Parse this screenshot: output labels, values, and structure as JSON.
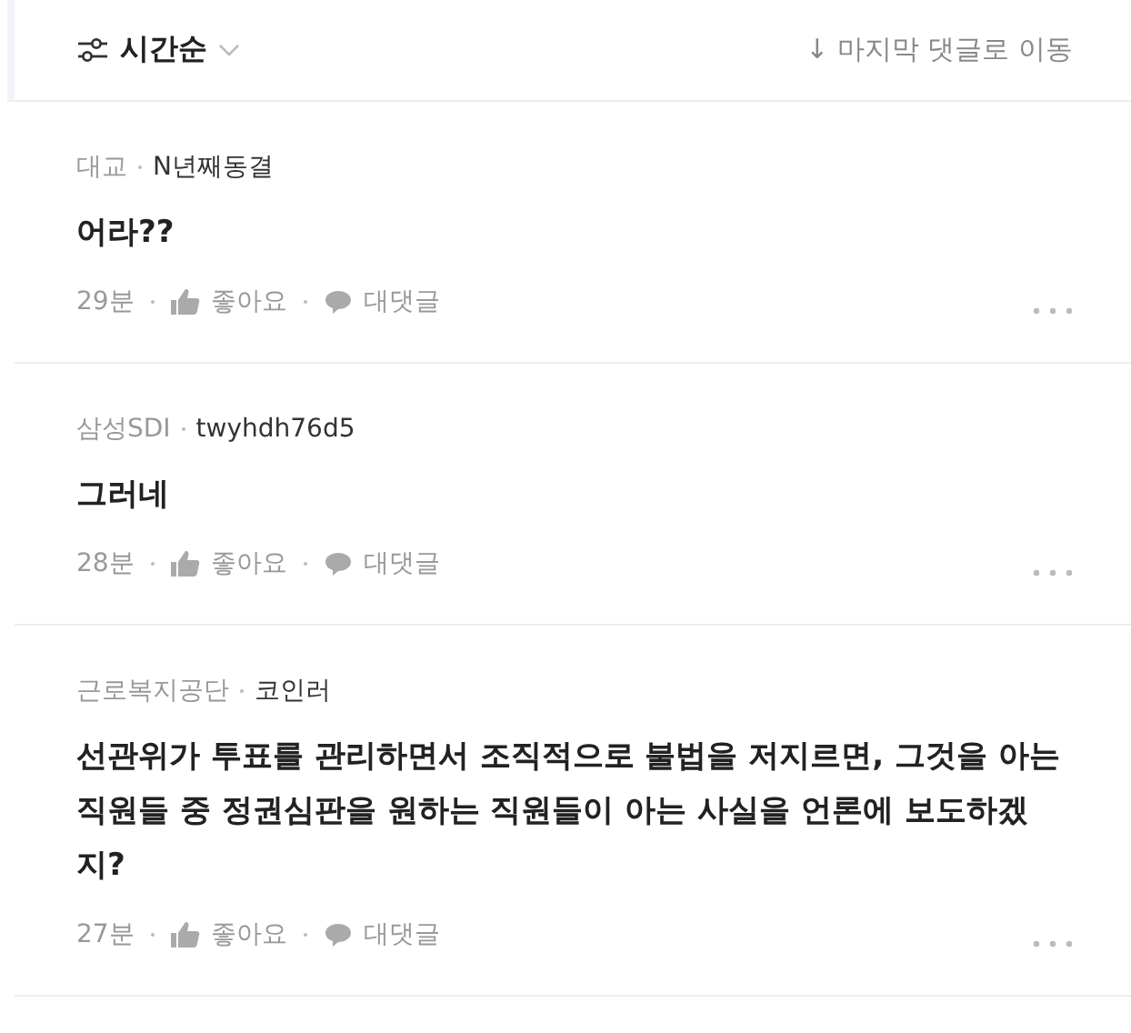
{
  "sort_bar": {
    "sort_label": "시간순",
    "jump_link": "↓ 마지막 댓글로 이동"
  },
  "comments": [
    {
      "company": "대교",
      "nickname": "N년째동결",
      "text": "어라??",
      "time": "29분",
      "like_label": "좋아요",
      "reply_label": "대댓글"
    },
    {
      "company": "삼성SDI",
      "nickname": "twyhdh76d5",
      "text": "그러네",
      "time": "28분",
      "like_label": "좋아요",
      "reply_label": "대댓글"
    },
    {
      "company": "근로복지공단",
      "nickname": "코인러",
      "text": "선관위가 투표를 관리하면서 조직적으로 불법을 저지르면, 그것을 아는 직원들 중 정권심판을 원하는 직원들이 아는 사실을 언론에 보도하겠지?",
      "time": "27분",
      "like_label": "좋아요",
      "reply_label": "대댓글"
    }
  ]
}
